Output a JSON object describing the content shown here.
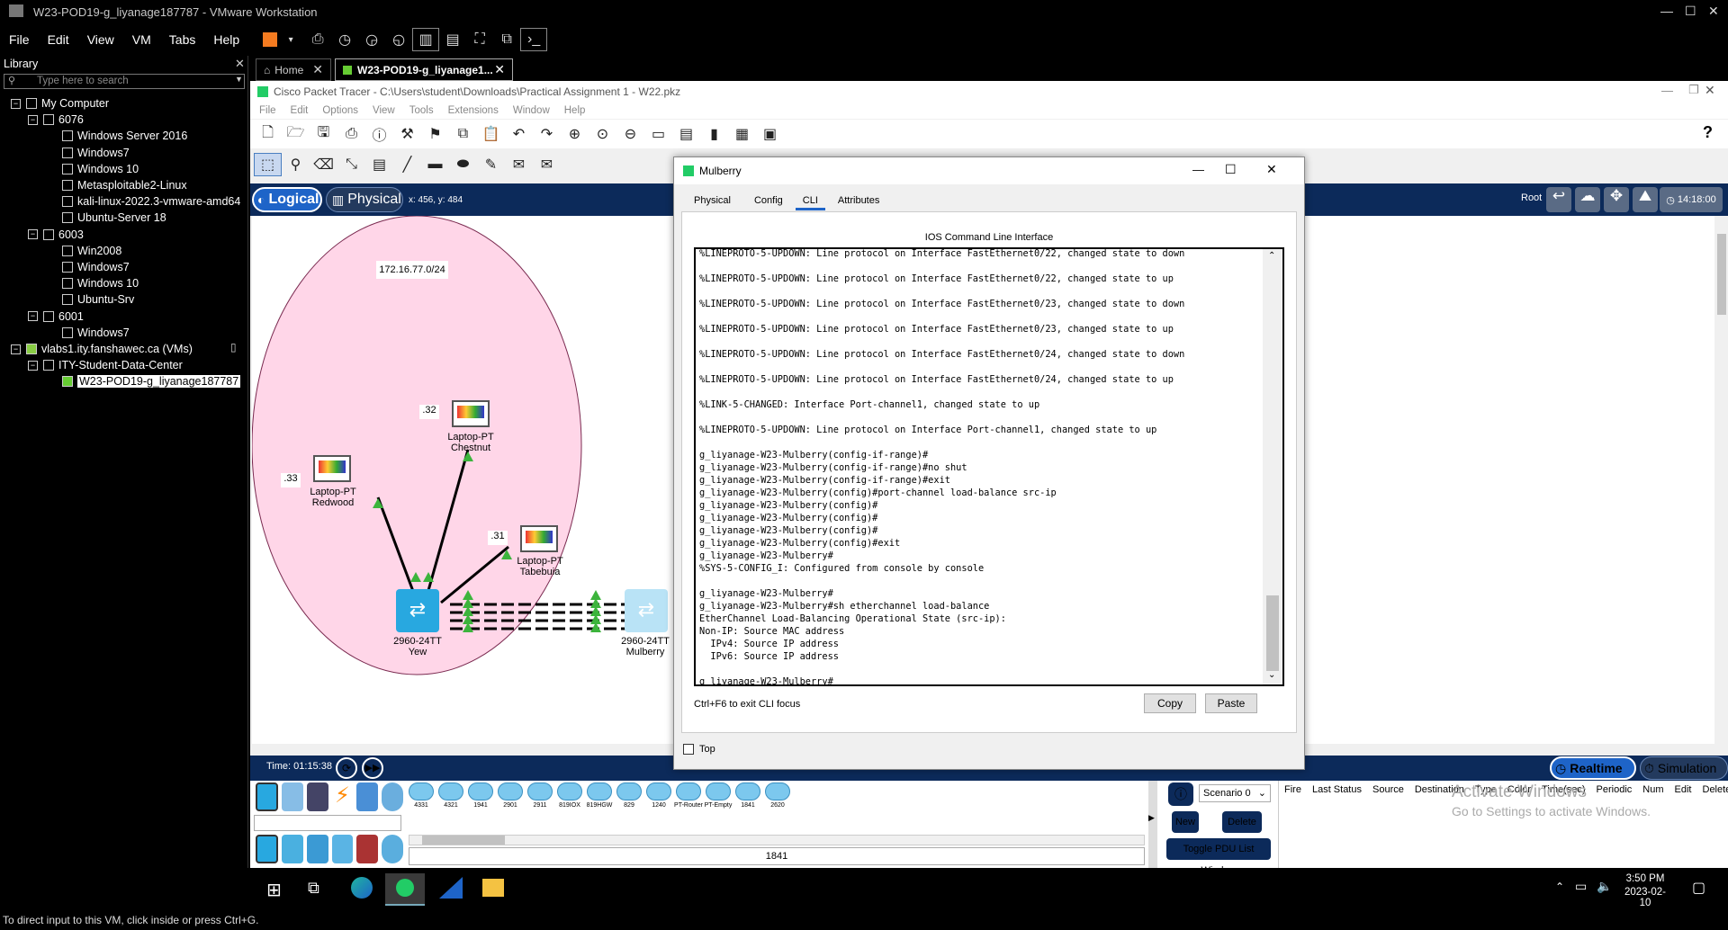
{
  "vmware": {
    "title": "W23-POD19-g_liyanage187787 - VMware Workstation",
    "menu": [
      "File",
      "Edit",
      "View",
      "VM",
      "Tabs",
      "Help"
    ],
    "status_text": "To direct input to this VM, click inside or press Ctrl+G."
  },
  "library": {
    "title": "Library",
    "search_placeholder": "Type here to search",
    "tree": [
      {
        "label": "My Computer",
        "level": 0,
        "type": "computer"
      },
      {
        "label": "6076",
        "level": 1,
        "type": "folder"
      },
      {
        "label": "Windows Server 2016",
        "level": 2,
        "type": "vm"
      },
      {
        "label": "Windows7",
        "level": 2,
        "type": "vm"
      },
      {
        "label": "Windows 10",
        "level": 2,
        "type": "vm"
      },
      {
        "label": "Metasploitable2-Linux",
        "level": 2,
        "type": "vm"
      },
      {
        "label": "kali-linux-2022.3-vmware-amd64",
        "level": 2,
        "type": "vm"
      },
      {
        "label": "Ubuntu-Server 18",
        "level": 2,
        "type": "vm"
      },
      {
        "label": "6003",
        "level": 1,
        "type": "folder"
      },
      {
        "label": "Win2008",
        "level": 2,
        "type": "vm"
      },
      {
        "label": "Windows7",
        "level": 2,
        "type": "vm"
      },
      {
        "label": "Windows 10",
        "level": 2,
        "type": "vm"
      },
      {
        "label": "Ubuntu-Srv",
        "level": 2,
        "type": "vm"
      },
      {
        "label": "6001",
        "level": 1,
        "type": "folder"
      },
      {
        "label": "Windows7",
        "level": 2,
        "type": "vm"
      },
      {
        "label": "vlabs1.ity.fanshawec.ca (VMs)",
        "level": 0,
        "type": "server"
      },
      {
        "label": "ITY-Student-Data-Center",
        "level": 1,
        "type": "datacenter"
      },
      {
        "label": "W23-POD19-g_liyanage187787",
        "level": 2,
        "type": "vm-running",
        "selected": true
      }
    ]
  },
  "tabs": [
    {
      "label": "Home"
    },
    {
      "label": "W23-POD19-g_liyanage1..."
    }
  ],
  "packet_tracer": {
    "title": "Cisco Packet Tracer - C:\\Users\\student\\Downloads\\Practical Assignment 1 - W22.pkz",
    "menu": [
      "File",
      "Edit",
      "Options",
      "View",
      "Tools",
      "Extensions",
      "Window",
      "Help"
    ],
    "logical_label": "Logical",
    "physical_label": "Physical",
    "coords": "x: 456, y: 484",
    "root_label": "Root",
    "clock": "14:18:00",
    "network_label": "172.16.77.0/24",
    "devices": [
      {
        "name": "Laptop-PT",
        "sub": "Chestnut",
        "ip": ".32"
      },
      {
        "name": "Laptop-PT",
        "sub": "Redwood",
        "ip": ".33"
      },
      {
        "name": "Laptop-PT",
        "sub": "Tabebuia",
        "ip": ".31"
      },
      {
        "name": "2960-24TT",
        "sub": "Yew"
      },
      {
        "name": "2960-24TT",
        "sub": "Mulberry"
      }
    ],
    "time_label": "Time: 01:15:38",
    "realtime": "Realtime",
    "simulation": "Simulation",
    "device_models": [
      "4331",
      "4321",
      "1941",
      "2901",
      "2911",
      "819IOX",
      "819HGW",
      "829",
      "1240",
      "PT-Router",
      "PT-Empty",
      "1841",
      "2620"
    ],
    "selected_model": "1841",
    "scenario": "Scenario 0",
    "new_btn": "New",
    "delete_btn": "Delete",
    "toggle_pdu": "Toggle PDU List Window",
    "pdu_cols": [
      "Fire",
      "Last Status",
      "Source",
      "Destination",
      "Type",
      "Color",
      "Time(sec)",
      "Periodic",
      "Num",
      "Edit",
      "Delete"
    ],
    "activate": "Activate Windows",
    "activate_sub": "Go to Settings to activate Windows."
  },
  "dialog": {
    "title": "Mulberry",
    "tabs": [
      "Physical",
      "Config",
      "CLI",
      "Attributes"
    ],
    "active_tab": "CLI",
    "heading": "IOS Command Line Interface",
    "cli_text": "%LINEPROTO-5-UPDOWN: Line protocol on Interface FastEthernet0/22, changed state to down\n\n%LINEPROTO-5-UPDOWN: Line protocol on Interface FastEthernet0/22, changed state to up\n\n%LINEPROTO-5-UPDOWN: Line protocol on Interface FastEthernet0/23, changed state to down\n\n%LINEPROTO-5-UPDOWN: Line protocol on Interface FastEthernet0/23, changed state to up\n\n%LINEPROTO-5-UPDOWN: Line protocol on Interface FastEthernet0/24, changed state to down\n\n%LINEPROTO-5-UPDOWN: Line protocol on Interface FastEthernet0/24, changed state to up\n\n%LINK-5-CHANGED: Interface Port-channel1, changed state to up\n\n%LINEPROTO-5-UPDOWN: Line protocol on Interface Port-channel1, changed state to up\n\ng_liyanage-W23-Mulberry(config-if-range)#\ng_liyanage-W23-Mulberry(config-if-range)#no shut\ng_liyanage-W23-Mulberry(config-if-range)#exit\ng_liyanage-W23-Mulberry(config)#port-channel load-balance src-ip\ng_liyanage-W23-Mulberry(config)#\ng_liyanage-W23-Mulberry(config)#\ng_liyanage-W23-Mulberry(config)#\ng_liyanage-W23-Mulberry(config)#exit\ng_liyanage-W23-Mulberry#\n%SYS-5-CONFIG_I: Configured from console by console\n\ng_liyanage-W23-Mulberry#\ng_liyanage-W23-Mulberry#sh etherchannel load-balance\nEtherChannel Load-Balancing Operational State (src-ip):\nNon-IP: Source MAC address\n  IPv4: Source IP address\n  IPv6: Source IP address\n\ng_liyanage-W23-Mulberry#",
    "hint": "Ctrl+F6 to exit CLI focus",
    "copy": "Copy",
    "paste": "Paste",
    "top": "Top"
  },
  "taskbar": {
    "time": "3:50 PM",
    "date": "2023-02-10"
  }
}
